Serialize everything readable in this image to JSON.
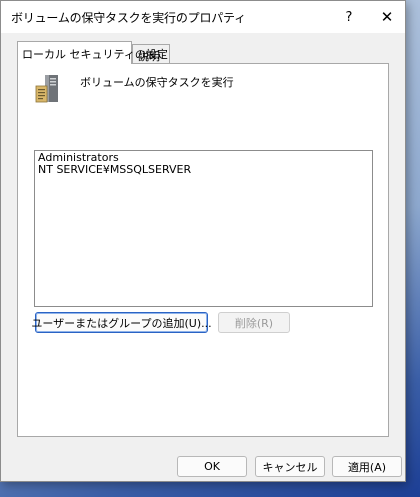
{
  "window": {
    "title": "ボリュームの保守タスクを実行のプロパティ",
    "help_label": "?",
    "close_label": "✕"
  },
  "tabs": [
    {
      "label": "ローカル セキュリティの設定",
      "active": true
    },
    {
      "label": "説明",
      "active": false
    }
  ],
  "policy": {
    "icon": "server-policy-icon",
    "name": "ボリュームの保守タスクを実行"
  },
  "members": [
    "Administrators",
    "NT SERVICE¥MSSQLSERVER"
  ],
  "buttons": {
    "add": "ユーザーまたはグループの追加(U)...",
    "remove": "削除(R)",
    "ok": "OK",
    "cancel": "キャンセル",
    "apply": "適用(A)"
  },
  "colors": {
    "focus_border": "#2a63c4",
    "disabled_text": "#9a9a9a"
  }
}
